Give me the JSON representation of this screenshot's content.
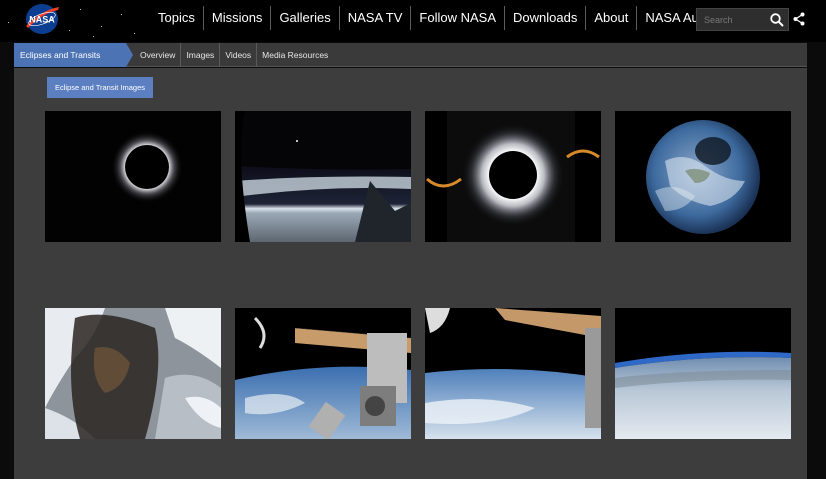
{
  "header": {
    "logo_text": "NASA",
    "nav": [
      "Topics",
      "Missions",
      "Galleries",
      "NASA TV",
      "Follow NASA",
      "Downloads",
      "About",
      "NASA Audiences"
    ],
    "search": {
      "placeholder": "Search"
    }
  },
  "subnav": {
    "breadcrumb": "Eclipses and Transits",
    "links": [
      "Overview",
      "Images",
      "Videos",
      "Media Resources"
    ]
  },
  "main": {
    "gallery_button": "Eclipse and Transit Images",
    "images": [
      {
        "icon": "eclipse-corona-image"
      },
      {
        "icon": "earth-limb-from-aircraft-image"
      },
      {
        "icon": "total-eclipse-corona-image"
      },
      {
        "icon": "earth-eclipse-shadow-image"
      },
      {
        "icon": "eclipse-shadow-over-us-image"
      },
      {
        "icon": "iss-over-earth-image"
      },
      {
        "icon": "iss-solar-array-earth-image"
      },
      {
        "icon": "earth-horizon-image"
      }
    ]
  },
  "colors": {
    "accent": "#4c74b5",
    "button": "#5b7fc0",
    "panel": "#3d3d3d",
    "topbar": "#000000"
  }
}
